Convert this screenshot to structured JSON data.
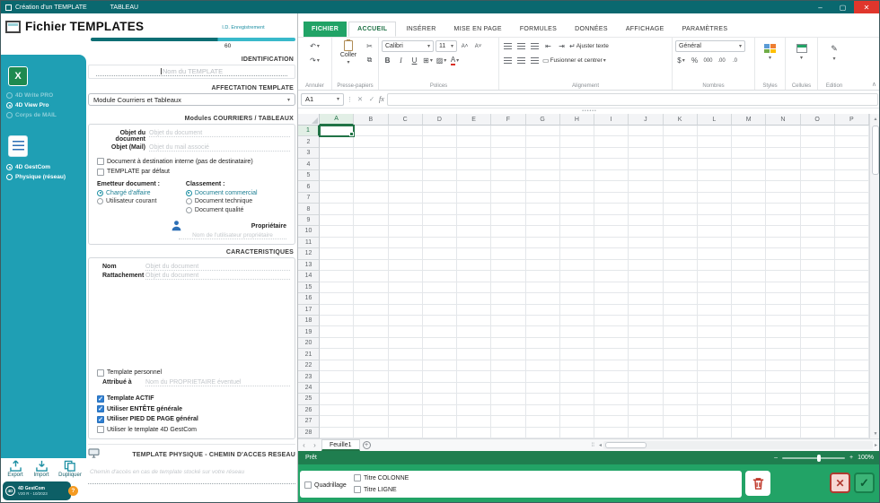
{
  "titlebar": {
    "title": "Création d'un TEMPLATE",
    "menu_item": "TABLEAU"
  },
  "window_controls": {
    "minimize": "–",
    "maximize": "▢",
    "close": "✕"
  },
  "left_panel": {
    "header": {
      "title": "Fichier TEMPLATES",
      "record_label": "I.D. Enregistrement",
      "record_value": "60"
    },
    "sidebar": {
      "excel_logo": "X",
      "doc_types": [
        {
          "label": "4D Write PRO",
          "state": "disabled"
        },
        {
          "label": "4D View Pro",
          "state": "selected"
        },
        {
          "label": "Corps de MAIL",
          "state": "disabled"
        }
      ],
      "storage_types": [
        {
          "label": "4D GestCom",
          "state": "selected"
        },
        {
          "label": "Physique (réseau)",
          "state": "normal"
        }
      ]
    },
    "identification": {
      "header": "IDENTIFICATION",
      "name_placeholder": "Nom du TEMPLATE"
    },
    "affectation": {
      "header": "AFFECTATION TEMPLATE",
      "module": "Module Courriers et Tableaux"
    },
    "modules": {
      "header": "Modules COURRIERS / TABLEAUX",
      "objet_document_label": "Objet du document",
      "objet_document_value": "Objet du document",
      "objet_mail_label": "Objet (Mail)",
      "objet_mail_value": "Objet du mail associé",
      "interne_checkbox": "Document à destination interne (pas de destinataire)",
      "defaut_checkbox": "TEMPLATE par défaut",
      "emetteur_label": "Emetteur document :",
      "emetteur_options": [
        {
          "label": "Chargé d'affaire",
          "selected": true
        },
        {
          "label": "Utilisateur courant",
          "selected": false
        }
      ],
      "classement_label": "Classement :",
      "classement_options": [
        {
          "label": "Document commercial",
          "selected": true
        },
        {
          "label": "Document technique",
          "selected": false
        },
        {
          "label": "Document qualité",
          "selected": false
        }
      ],
      "proprietaire_label": "Propriétaire",
      "proprietaire_value": "Nom de l'utilisateur propriétaire"
    },
    "caracteristiques": {
      "header": "CARACTERISTIQUES",
      "nom_label": "Nom",
      "nom_value": "Objet du document",
      "rattachement_label": "Rattachement",
      "rattachement_value": "Objet du document",
      "personnel_checkbox": "Template personnel",
      "attribue_label": "Attribué à",
      "attribue_value": "Nom du PROPRIETAIRE éventuel",
      "actif_checkbox": "Template ACTIF",
      "entete_checkbox": "Utiliser ENTÊTE générale",
      "pied_checkbox": "Utiliser PIED DE PAGE général",
      "gestcom_checkbox": "Utiliser le template 4D GestCom"
    },
    "physique": {
      "header": "TEMPLATE PHYSIQUE - CHEMIN D'ACCES RESEAU",
      "chemin_value": "Chemin d'accès en cas de template stocké sur votre réseau"
    },
    "footer": {
      "export": "Export",
      "import": "Import",
      "dupliquer": "Dupliquer",
      "logo": "4D",
      "app_name": "4D GestCom",
      "app_version": "V20 R - 10/2023",
      "help": "?"
    }
  },
  "spreadsheet": {
    "ribbon_tabs": [
      "FICHIER",
      "ACCUEIL",
      "INSÉRER",
      "MISE EN PAGE",
      "FORMULES",
      "DONNÉES",
      "AFFICHAGE",
      "PARAMÈTRES"
    ],
    "file_tab": "FICHIER",
    "active_tab": "ACCUEIL",
    "ribbon": {
      "group_annuler": "Annuler",
      "group_presse_papiers": "Presse-papiers",
      "group_polices": "Polices",
      "group_alignement": "Alignement",
      "group_nombres": "Nombres",
      "coller": "Coller",
      "font_name": "Calibri",
      "font_size": "11",
      "bold": "B",
      "italic": "I",
      "underline": "U",
      "ajuster_texte": "Ajuster texte",
      "fusionner": "Fusionner et centrer",
      "format_nombre": "Général",
      "thousands": "000",
      "styles": "Styles",
      "cellules": "Cellules",
      "edition": "Edition"
    },
    "formula_bar": {
      "cell_ref": "A1",
      "fx": "fx"
    },
    "grid": {
      "columns": [
        "A",
        "B",
        "C",
        "D",
        "E",
        "F",
        "G",
        "H",
        "I",
        "J",
        "K",
        "L",
        "M",
        "N",
        "O",
        "P"
      ],
      "row_count": 28,
      "selected_column": "A",
      "selected_row": 1
    },
    "sheet_bar": {
      "active_sheet": "Feuille1"
    },
    "status_bar": {
      "status": "Prêt",
      "zoom": "100%"
    }
  },
  "bottom_panel": {
    "quadrillage": {
      "label": "Quadrillage",
      "checked": false
    },
    "titre_colonne": {
      "label": "Titre COLONNE",
      "checked": false
    },
    "titre_ligne": {
      "label": "Titre LIGNE",
      "checked": false
    }
  },
  "icons": {
    "undo": "↶",
    "redo": "↷",
    "dropdown": "▾",
    "cut": "✂",
    "copy": "⧉",
    "grow_font": "A˄",
    "shrink_font": "A˅",
    "borders": "⊞",
    "fill": "▨",
    "font_color": "A",
    "indent_dec": "⇤",
    "indent_inc": "⇥",
    "wrap": "↵",
    "merge": "▭",
    "currency": "$",
    "percent": "%",
    "inc_decimal": ".00",
    "dec_decimal": ".0",
    "edition": "✎",
    "collapse": "∧",
    "cancel": "✕",
    "accept": "✓",
    "handle": "⋮",
    "splitter_dots": "••••••",
    "prev": "‹",
    "next": "›",
    "add": "+",
    "vdots": "⁞⁞",
    "left": "◂",
    "right": "▸",
    "up": "▲",
    "down": "▼",
    "zoom_out": "–",
    "zoom_in": "+"
  },
  "colors": {
    "titlebar": "#0a686f",
    "sidebar_teal": "#1f9fb4",
    "excel_green": "#21a366",
    "status_green": "#1f7e4f",
    "panel_green": "#22a366",
    "selection_green": "#217346",
    "checkbox_blue": "#2f7fd1",
    "radio_teal": "#1d8fa3",
    "close_red": "#e0362c"
  }
}
